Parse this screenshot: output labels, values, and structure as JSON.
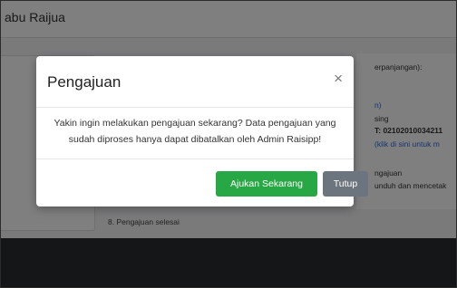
{
  "app": {
    "title": "abu Raijua"
  },
  "background": {
    "right_lines": [
      {
        "text": "erpanjangan):",
        "color": "#333333",
        "bold": false
      },
      {
        "text": "n)",
        "color": "#2b6de0",
        "bold": false
      },
      {
        "text": "sing",
        "color": "#333333",
        "bold": false
      },
      {
        "text": "T: 02102010034211",
        "color": "#333333",
        "bold": true
      },
      {
        "text": "(klik di sini untuk m",
        "color": "#2b6de0",
        "bold": false
      },
      {
        "text": "ngajuan",
        "color": "#333333",
        "bold": false
      },
      {
        "text": "unduh dan mencetak",
        "color": "#333333",
        "bold": false
      }
    ],
    "step_8": "8. Pengajuan selesai"
  },
  "modal": {
    "title": "Pengajuan",
    "close_symbol": "×",
    "message": "Yakin ingin melakukan pengajuan sekarang? Data pengajuan yang sudah diproses hanya dapat dibatalkan oleh Admin Raisipp!",
    "confirm_label": "Ajukan Sekarang",
    "cancel_label": "Tutup"
  },
  "colors": {
    "confirm": "#28a745",
    "cancel": "#6c757d",
    "link": "#2b6de0"
  }
}
